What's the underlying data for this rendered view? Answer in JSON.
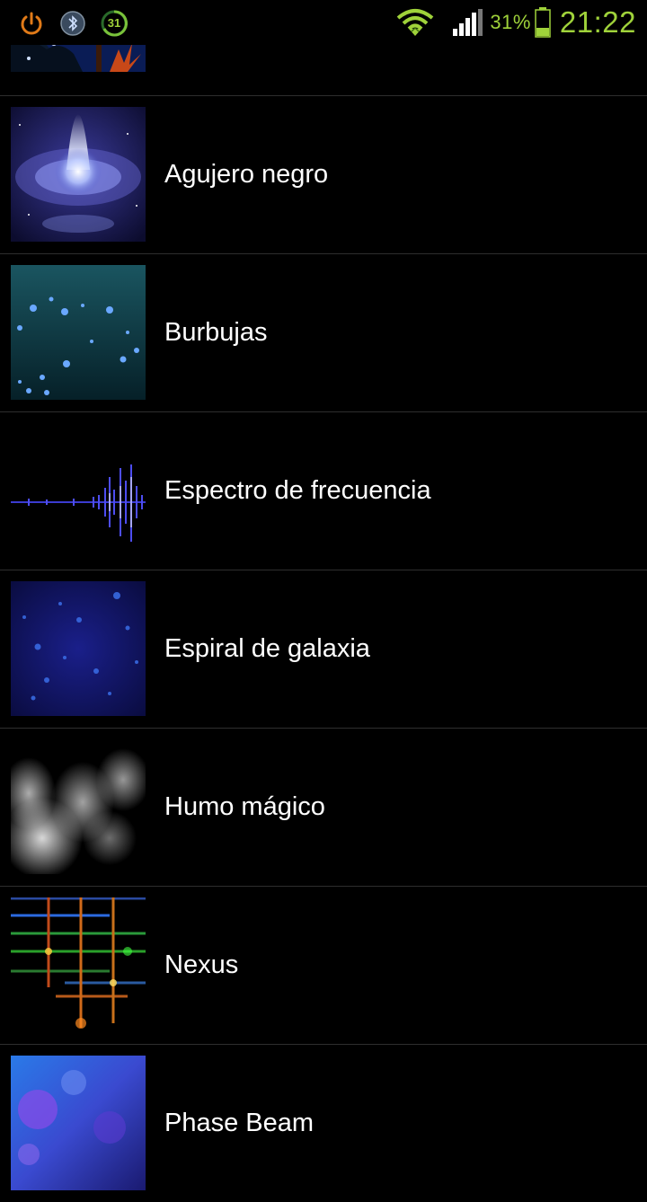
{
  "status_bar": {
    "icons_left": [
      "power-icon",
      "bluetooth-icon",
      "calendar-icon"
    ],
    "calendar_day": "31",
    "battery_percent": "31%",
    "time": "21:22",
    "accent_color": "#9fd23a"
  },
  "wallpapers": {
    "items": [
      {
        "label": "Agujero negro",
        "thumbnail": "black-hole-thumbnail"
      },
      {
        "label": "Burbujas",
        "thumbnail": "bubbles-thumbnail"
      },
      {
        "label": "Espectro de frecuencia",
        "thumbnail": "frequency-spectrum-thumbnail"
      },
      {
        "label": "Espiral de galaxia",
        "thumbnail": "galaxy-spiral-thumbnail"
      },
      {
        "label": "Humo mágico",
        "thumbnail": "magic-smoke-thumbnail"
      },
      {
        "label": "Nexus",
        "thumbnail": "nexus-thumbnail"
      },
      {
        "label": "Phase Beam",
        "thumbnail": "phase-beam-thumbnail"
      }
    ]
  }
}
